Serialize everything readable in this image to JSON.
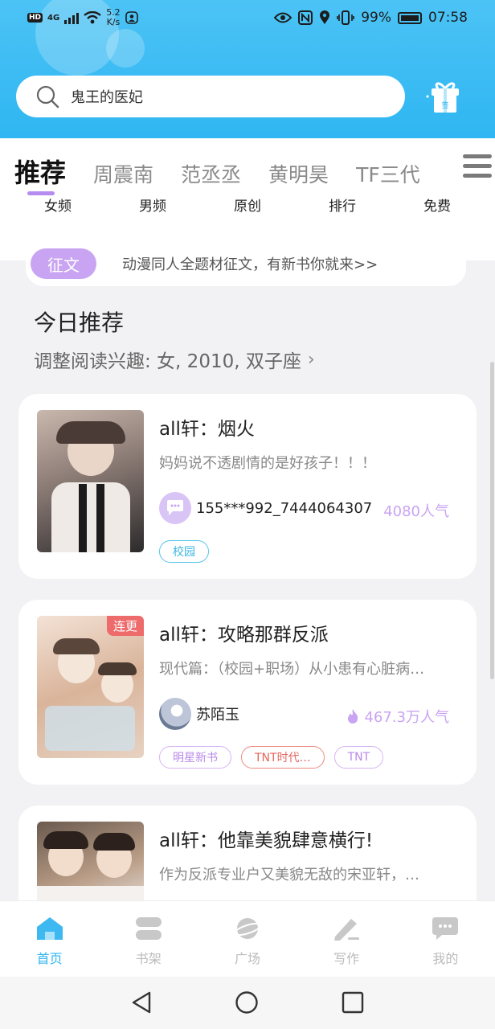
{
  "status_bar": {
    "network": "4G",
    "speed_value": "5.2",
    "speed_unit": "K/s",
    "battery": "99%",
    "time": "07:58"
  },
  "search": {
    "value": "鬼王的医妃"
  },
  "top_tabs": [
    "推荐",
    "周震南",
    "范丞丞",
    "黄明昊",
    "TF三代"
  ],
  "sub_tabs": [
    "女频",
    "男频",
    "原创",
    "排行",
    "免费"
  ],
  "notice": {
    "badge": "征文",
    "text": "动漫同人全题材征文，有新书你就来>>"
  },
  "section": {
    "title": "今日推荐",
    "subtitle": "调整阅读兴趣: 女, 2010, 双子座"
  },
  "books": [
    {
      "title": "all轩：烟火",
      "desc": "妈妈说不透剧情的是好孩子！！！",
      "author": "155***992_7444064307",
      "popularity": "4080人气",
      "tags": [
        "校园"
      ]
    },
    {
      "title": "all轩：攻略那群反派",
      "cover_tag": "连更",
      "desc": "现代篇：（校园+职场）从小患有心脏病…",
      "author": "苏陌玉",
      "popularity": "467.3万人气",
      "tags": [
        "明星新书",
        "TNT时代…",
        "TNT"
      ]
    },
    {
      "title": "all轩：他靠美貌肆意横行!",
      "desc": "作为反派专业户又美貌无敌的宋亚轩，…"
    }
  ],
  "bottom_nav": [
    "首页",
    "书架",
    "广场",
    "写作",
    "我的"
  ],
  "colors": {
    "brand": "#2fb6f2",
    "accent": "#c9a4f2",
    "tag_red": "#ee6b6b"
  }
}
